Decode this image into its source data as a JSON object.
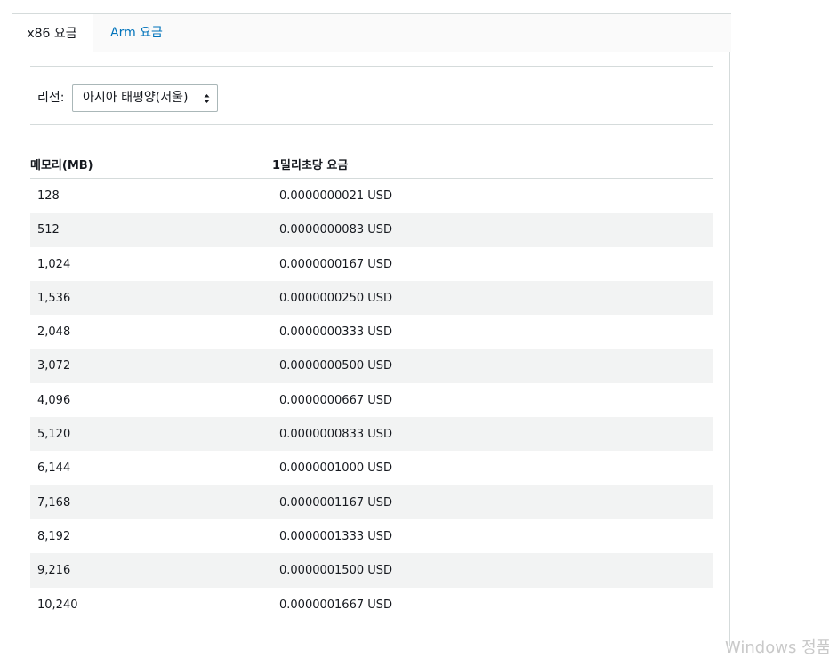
{
  "tabs": [
    {
      "label": "x86 요금",
      "active": true
    },
    {
      "label": "Arm 요금",
      "active": false
    }
  ],
  "region": {
    "label": "리전:",
    "selected": "아시아 태평양(서울)"
  },
  "table": {
    "headers": [
      "메모리(MB)",
      "1밀리초당 요금"
    ],
    "rows": [
      {
        "memory": "128",
        "price": "0.0000000021 USD"
      },
      {
        "memory": "512",
        "price": "0.0000000083 USD"
      },
      {
        "memory": "1,024",
        "price": "0.0000000167 USD"
      },
      {
        "memory": "1,536",
        "price": "0.0000000250 USD"
      },
      {
        "memory": "2,048",
        "price": "0.0000000333 USD"
      },
      {
        "memory": "3,072",
        "price": "0.0000000500 USD"
      },
      {
        "memory": "4,096",
        "price": "0.0000000667 USD"
      },
      {
        "memory": "5,120",
        "price": "0.0000000833 USD"
      },
      {
        "memory": "6,144",
        "price": "0.0000001000 USD"
      },
      {
        "memory": "7,168",
        "price": "0.0000001167 USD"
      },
      {
        "memory": "8,192",
        "price": "0.0000001333 USD"
      },
      {
        "memory": "9,216",
        "price": "0.0000001500 USD"
      },
      {
        "memory": "10,240",
        "price": "0.0000001667 USD"
      }
    ]
  },
  "overlay": {
    "watermark": "Windows 정품"
  },
  "colors": {
    "link": "#0073bb",
    "border": "#d5dbdb",
    "stripe": "#f2f3f3",
    "text": "#16191f"
  }
}
